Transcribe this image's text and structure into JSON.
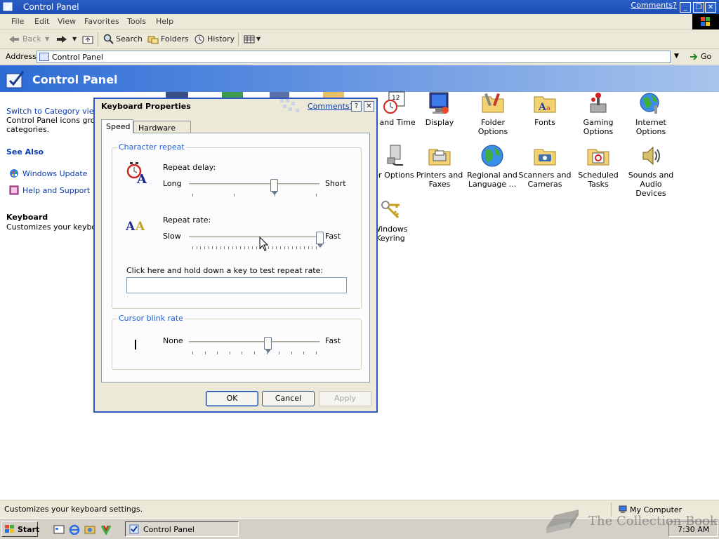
{
  "window": {
    "title": "Control Panel",
    "comments_link": "Comments?",
    "menu": [
      "File",
      "Edit",
      "View",
      "Favorites",
      "Tools",
      "Help"
    ],
    "toolbar": {
      "back": "Back",
      "search": "Search",
      "folders": "Folders",
      "history": "History"
    },
    "address": {
      "label": "Address",
      "value": "Control Panel",
      "go": "Go"
    },
    "banner_title": "Control Panel"
  },
  "left_pane": {
    "switch_link": "Switch to Category view",
    "switch_desc_1": "Control Panel icons group",
    "switch_desc_2": "categories.",
    "see_also": "See Also",
    "links": [
      "Windows Update",
      "Help and Support"
    ],
    "selected_title": "Keyboard",
    "selected_desc": "Customizes your keyboar"
  },
  "items": [
    {
      "label": "e and Time",
      "icon": "date-time-icon"
    },
    {
      "label": "Display",
      "icon": "display-icon"
    },
    {
      "label": "Folder Options",
      "icon": "folder-options-icon"
    },
    {
      "label": "Fonts",
      "icon": "fonts-folder-icon"
    },
    {
      "label": "Gaming Options",
      "icon": "gaming-options-icon"
    },
    {
      "label": "Internet Options",
      "icon": "internet-options-icon"
    },
    {
      "label": "er Options",
      "icon": "power-options-icon"
    },
    {
      "label": "Printers and Faxes",
      "icon": "printers-icon"
    },
    {
      "label": "Regional and Language ...",
      "icon": "globe-icon"
    },
    {
      "label": "Scanners and Cameras",
      "icon": "scanner-icon"
    },
    {
      "label": "Scheduled Tasks",
      "icon": "scheduled-tasks-icon"
    },
    {
      "label": "Sounds and Audio Devices",
      "icon": "speaker-icon"
    },
    {
      "label": "Windows Keyring",
      "icon": "keyring-icon"
    }
  ],
  "status": {
    "text": "Customizes your keyboard settings.",
    "zone": "My Computer"
  },
  "taskbar": {
    "start": "Start",
    "task": "Control Panel",
    "clock": "7:30 AM",
    "watermark": "The Collection Book"
  },
  "dialog": {
    "title": "Keyboard Properties",
    "comments_link": "Comments?",
    "tabs": [
      "Speed",
      "Hardware"
    ],
    "char_repeat": {
      "legend": "Character repeat",
      "repeat_delay_label": "Repeat delay:",
      "delay_min": "Long",
      "delay_max": "Short",
      "delay_level": 0.65,
      "repeat_rate_label": "Repeat rate:",
      "rate_min": "Slow",
      "rate_max": "Fast",
      "rate_level": 1.0,
      "test_label": "Click here and hold down a key to test repeat rate:",
      "test_value": ""
    },
    "cursor_blink": {
      "legend": "Cursor blink rate",
      "min": "None",
      "max": "Fast",
      "level": 0.6
    },
    "buttons": {
      "ok": "OK",
      "cancel": "Cancel",
      "apply": "Apply"
    }
  }
}
